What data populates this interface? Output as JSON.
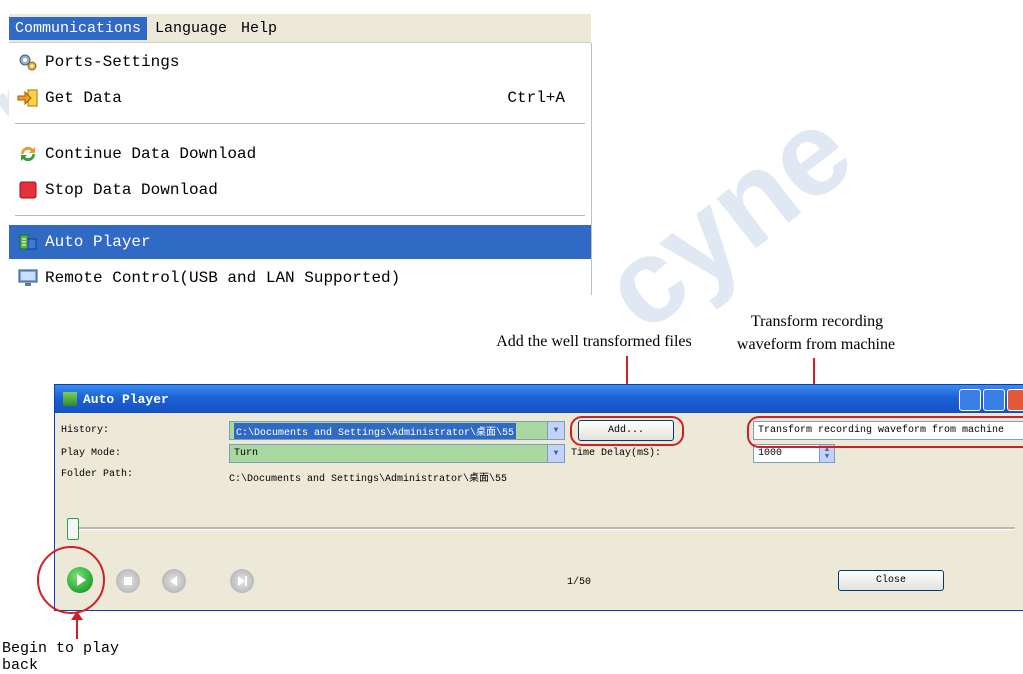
{
  "menubar": {
    "items": [
      {
        "label": "Communications",
        "active": true
      },
      {
        "label": "Language",
        "active": false
      },
      {
        "label": "Help",
        "active": false
      }
    ]
  },
  "menu": {
    "items": [
      {
        "label": "Ports-Settings",
        "shortcut": "",
        "icon": "gears-icon",
        "selected": false
      },
      {
        "label": "Get Data",
        "shortcut": "Ctrl+A",
        "icon": "get-data-icon",
        "selected": false
      },
      {
        "label": "Continue Data Download",
        "shortcut": "",
        "icon": "refresh-icon",
        "selected": false
      },
      {
        "label": "Stop Data Download",
        "shortcut": "",
        "icon": "stop-icon",
        "selected": false
      },
      {
        "label": "Auto Player",
        "shortcut": "",
        "icon": "auto-player-icon",
        "selected": true
      },
      {
        "label": "Remote Control(USB and LAN Supported)",
        "shortcut": "",
        "icon": "monitor-icon",
        "selected": false
      }
    ]
  },
  "annotations": {
    "add_note": "Add the well transformed files",
    "transform_note_line1": "Transform recording",
    "transform_note_line2": "waveform from machine",
    "play_note": "Begin to play back"
  },
  "window": {
    "title": "Auto Player",
    "history_label": "History:",
    "history_value": "C:\\Documents and Settings\\Administrator\\桌面\\55",
    "add_button": "Add...",
    "transform_button": "Transform recording waveform from machine",
    "play_mode_label": "Play Mode:",
    "play_mode_value": "Turn",
    "time_delay_label": "Time Delay(mS):",
    "time_delay_value": "1000",
    "folder_path_label": "Folder Path:",
    "folder_path_value": "C:\\Documents and Settings\\Administrator\\桌面\\55",
    "counter": "1/50",
    "close_button": "Close",
    "slider_position": 0.0
  },
  "colors": {
    "menu_highlight": "#316ac5",
    "annotation_red": "#d21f26",
    "titlebar_blue": "#1b62d6",
    "combo_green": "#a9d9a0",
    "play_green": "#2fae3a"
  }
}
